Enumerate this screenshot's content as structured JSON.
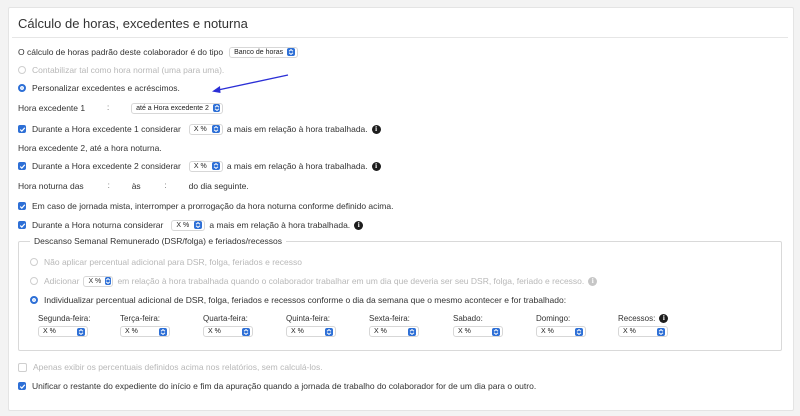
{
  "title": "Cálculo de horas, excedentes e noturna",
  "default_type": {
    "text": "O cálculo de horas padrão deste colaborador é do tipo",
    "value": "Banco de horas"
  },
  "normal_hour_option": "Contabilizar tal como hora normal (uma para uma).",
  "custom_option": "Personalizar excedentes e acréscimos.",
  "excedente1": {
    "label": "Hora excedente 1",
    "time": ":",
    "until": "até a Hora excedente 2"
  },
  "excedente1_pct": {
    "text_before": "Durante a Hora excedente 1 considerar",
    "value": "X %",
    "text_after": "a mais em relação à hora trabalhada."
  },
  "excedente2_label": "Hora excedente 2, até a hora noturna.",
  "excedente2_pct": {
    "text_before": "Durante a Hora excedente 2 considerar",
    "value": "X %",
    "text_after": "a mais em relação à hora trabalhada."
  },
  "noturna": {
    "label": "Hora noturna das",
    "from": ":",
    "between": "às",
    "to": ":",
    "suffix": "do dia seguinte."
  },
  "mista": "Em caso de jornada mista, interromper a prorrogação da hora noturna conforme definido acima.",
  "noturna_pct": {
    "text_before": "Durante a Hora noturna considerar",
    "value": "X %",
    "text_after": "a mais em relação à hora trabalhada."
  },
  "dsr": {
    "legend": "Descanso Semanal Remunerado (DSR/folga) e feriados/recessos",
    "no_apply": "Não aplicar percentual adicional para DSR, folga, feriados e recesso",
    "add_before": "Adicionar",
    "add_value": "X %",
    "add_after": "em relação à hora trabalhada quando o colaborador trabalhar em um dia que deveria ser seu DSR, folga, feriado e recesso.",
    "individual": "Individualizar percentual adicional de DSR, folga, feriados e recessos conforme o dia da semana que o mesmo acontecer e for trabalhado:",
    "days": [
      {
        "label": "Segunda-feira:",
        "value": "X %"
      },
      {
        "label": "Terça-feira:",
        "value": "X %"
      },
      {
        "label": "Quarta-feira:",
        "value": "X %"
      },
      {
        "label": "Quinta-feira:",
        "value": "X %"
      },
      {
        "label": "Sexta-feira:",
        "value": "X %"
      },
      {
        "label": "Sabado:",
        "value": "X %"
      },
      {
        "label": "Domingo:",
        "value": "X %"
      },
      {
        "label": "Recessos:",
        "value": "X %"
      }
    ]
  },
  "only_show": "Apenas exibir os percentuais definidos acima nos relatórios, sem calculá-los.",
  "unify": "Unificar o restante do expediente do início e fim da apuração quando a jornada de trabalho do colaborador for de um dia para o outro.",
  "colors": {
    "accent": "#2d6fd6",
    "arrow": "#2b2fd6"
  }
}
